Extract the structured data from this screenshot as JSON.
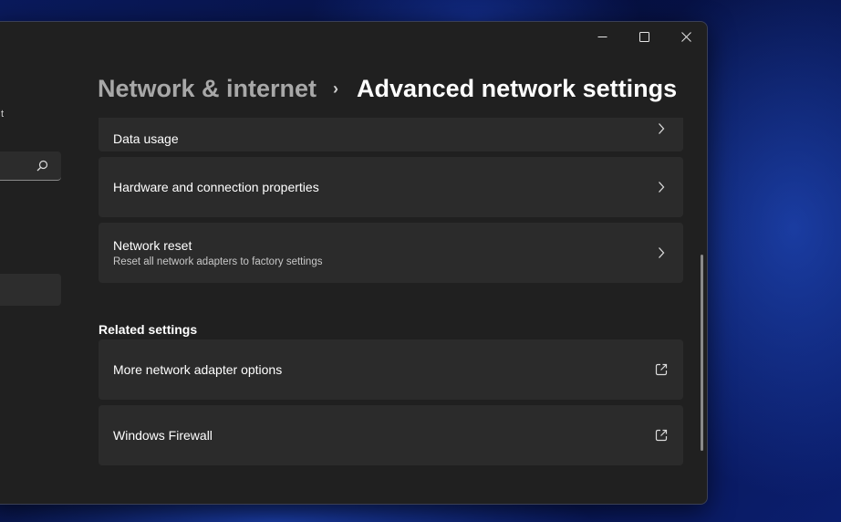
{
  "breadcrumb": {
    "parent": "Network & internet",
    "separator": "›",
    "current": "Advanced network settings"
  },
  "left_nav": {
    "fragment_text": "t",
    "search_icon": "search-icon"
  },
  "window_controls": {
    "minimize": "minimize-icon",
    "maximize": "maximize-icon",
    "close": "close-icon"
  },
  "items": [
    {
      "title": "Data usage",
      "subtitle": "",
      "icon": "chevron-right-icon"
    },
    {
      "title": "Hardware and connection properties",
      "subtitle": "",
      "icon": "chevron-right-icon"
    },
    {
      "title": "Network reset",
      "subtitle": "Reset all network adapters to factory settings",
      "icon": "chevron-right-icon"
    }
  ],
  "related": {
    "heading": "Related settings",
    "items": [
      {
        "title": "More network adapter options",
        "icon": "external-link-icon"
      },
      {
        "title": "Windows Firewall",
        "icon": "external-link-icon"
      }
    ]
  },
  "colors": {
    "window_bg": "#202020",
    "card_bg": "#2b2b2b",
    "text_primary": "#ffffff",
    "text_secondary": "#a8a8a8"
  }
}
